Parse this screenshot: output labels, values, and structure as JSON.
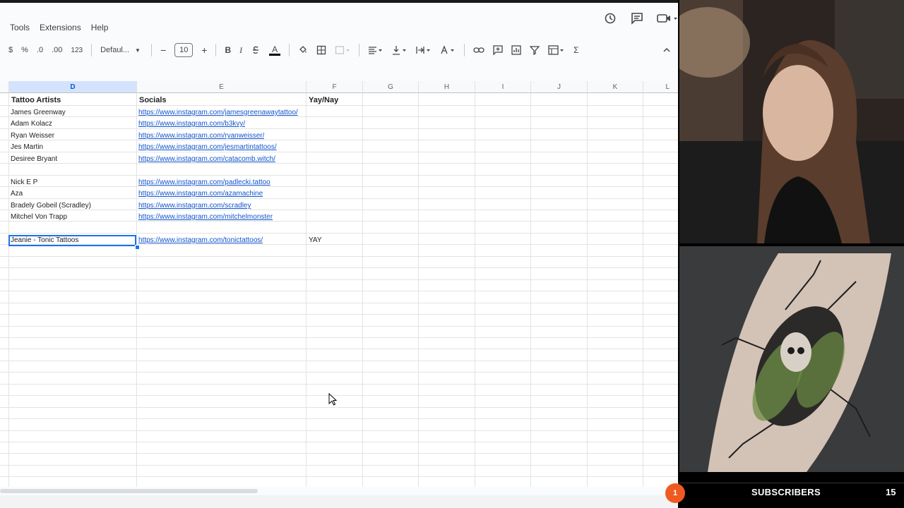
{
  "menu": [
    "Tools",
    "Extensions",
    "Help"
  ],
  "toolbar": {
    "currency": "$",
    "percent": "%",
    "dec_decrease": ".0",
    "dec_increase": ".00",
    "number_format": "123",
    "font": "Defaul...",
    "font_size": "10",
    "minus": "−",
    "plus": "+",
    "bold": "B",
    "italic": "I",
    "text_color": "A",
    "sigma": "Σ"
  },
  "grid": {
    "selected_column": "D",
    "columns": [
      "D",
      "E",
      "F",
      "G",
      "H",
      "I",
      "J",
      "K",
      "L"
    ],
    "headers": {
      "artists": "Tattoo Artists",
      "socials": "Socials",
      "vote": "Yay/Nay"
    },
    "rows": [
      {
        "artist": "James Greenway",
        "social": "https://www.instagram.com/jamesgreenawaytattoo/",
        "vote": ""
      },
      {
        "artist": "Adam Kolacz",
        "social": "https://www.instagram.com/b3kvy/",
        "vote": ""
      },
      {
        "artist": "Ryan Weisser",
        "social": "https://www.instagram.com/ryanweisser/",
        "vote": ""
      },
      {
        "artist": "Jes Martin",
        "social": "https://www.instagram.com/jesmartintattoos/",
        "vote": ""
      },
      {
        "artist": "Desiree Bryant",
        "social": "https://www.instagram.com/catacomb.witch/",
        "vote": ""
      },
      {
        "artist": "",
        "social": "",
        "vote": ""
      },
      {
        "artist": "Nick E P",
        "social": "https://www.instagram.com/padlecki.tattoo",
        "vote": ""
      },
      {
        "artist": "Aza",
        "social": "https://www.instagram.com/azamachine",
        "vote": ""
      },
      {
        "artist": "Bradely Gobeil (Scradley)",
        "social": "https://www.instagram.com/scradley",
        "vote": ""
      },
      {
        "artist": "Mitchel Von Trapp",
        "social": "https://www.instagram.com/mitchelmonster",
        "vote": ""
      },
      {
        "artist": "",
        "social": "",
        "vote": ""
      },
      {
        "artist": "Jeanie - Tonic Tattoos",
        "social": "https://www.instagram.com/tonictattoos/",
        "vote": "YAY"
      }
    ]
  },
  "overlay": {
    "subscribers_label": "SUBSCRIBERS",
    "subscribers_count": "15",
    "badge": "1",
    "badge_color": "#ef5a21"
  },
  "colors": {
    "selection": "#1a73e8",
    "link": "#1155cc",
    "header_selected": "#d3e3fd"
  }
}
